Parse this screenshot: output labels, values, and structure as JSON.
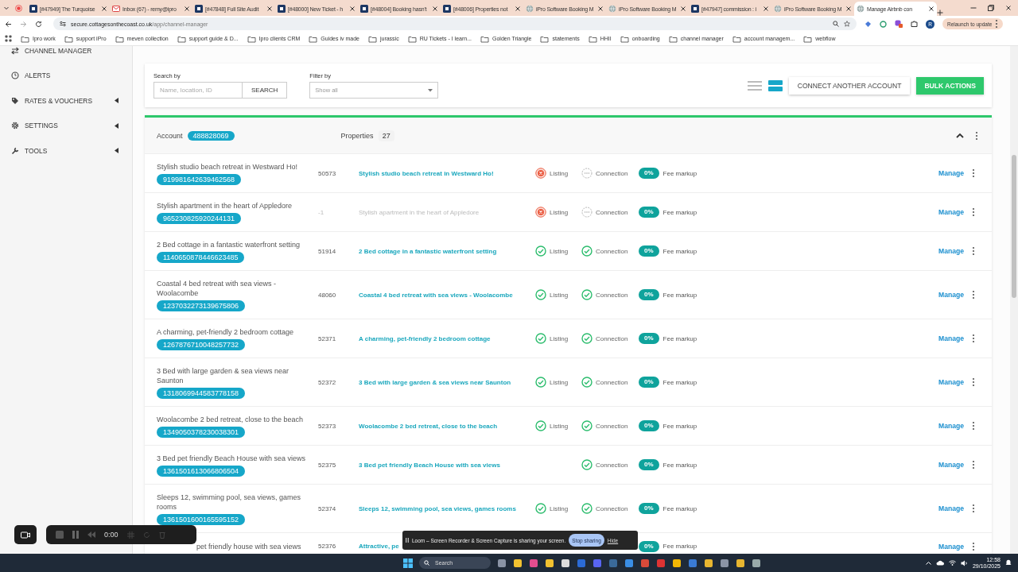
{
  "browser": {
    "tabs": [
      {
        "title": "[#47949] The Turquoise",
        "kind": "ticket",
        "selected": false
      },
      {
        "title": "Inbox (67) - remy@ipro",
        "kind": "mail",
        "selected": false
      },
      {
        "title": "[#47848] Full Site Audit",
        "kind": "ticket",
        "selected": false
      },
      {
        "title": "[#48000] New Ticket - h",
        "kind": "ticket",
        "selected": false
      },
      {
        "title": "[#48004] Booking hasn't",
        "kind": "ticket",
        "selected": false
      },
      {
        "title": "[#48006] Properties not",
        "kind": "ticket",
        "selected": false
      },
      {
        "title": "iPro Software Booking M",
        "kind": "globe",
        "selected": false
      },
      {
        "title": "iPro Software Booking M",
        "kind": "globe",
        "selected": false
      },
      {
        "title": "[#47947] commission : i",
        "kind": "ticket",
        "selected": false
      },
      {
        "title": "iPro Software Booking M",
        "kind": "globe",
        "selected": false
      },
      {
        "title": "Manage Airbnb con",
        "kind": "globe",
        "selected": true
      }
    ],
    "address": {
      "host": "secure.cottagesonthecoast.co.uk",
      "path": "/app/channel-manager"
    },
    "profile_initial": "R",
    "relaunch": "Relaunch to update",
    "bookmarks": [
      "Ipro work",
      "support iPro",
      "meven collection",
      "support guide & D...",
      "Ipro clients CRM",
      "Guides iv made",
      "jurassic",
      "RU Tickets - I learn...",
      "Golden Triangle",
      "statements",
      "HHII",
      "onboarding",
      "channel manager",
      "account managem...",
      "webflow"
    ]
  },
  "sidebar": {
    "items": [
      {
        "label": "CHANNEL MANAGER",
        "kind": "arrows",
        "has_submenu": false
      },
      {
        "label": "ALERTS",
        "kind": "clock",
        "has_submenu": false
      },
      {
        "label": "RATES & VOUCHERS",
        "kind": "tag",
        "has_submenu": true
      },
      {
        "label": "SETTINGS",
        "kind": "gear",
        "has_submenu": true
      },
      {
        "label": "TOOLS",
        "kind": "wrench",
        "has_submenu": true
      }
    ]
  },
  "filters": {
    "search": {
      "label": "Search by",
      "placeholder": "Name, location, ID",
      "button": "SEARCH"
    },
    "filter": {
      "label": "Filter by",
      "value": "Show all"
    },
    "views": [
      {
        "kind": "list",
        "selected": false
      },
      {
        "kind": "cards",
        "selected": true
      }
    ],
    "connect_button": "CONNECT ANOTHER ACCOUNT",
    "bulk_button": "BULK ACTIONS"
  },
  "account": {
    "label": "Account",
    "id": "488828069",
    "properties_label": "Properties",
    "properties_count": "27",
    "expanded": true,
    "listings": [
      {
        "kind": "full",
        "title": "Stylish studio beach retreat in Westward Ho!",
        "airbnb_id": "919981642639462568",
        "property_id": "50573",
        "link": "Stylish studio beach retreat in Westward Ho!",
        "linked": true,
        "listing": {
          "label": "Listing",
          "ok": false
        },
        "connection": {
          "label": "Connection",
          "connected": false
        },
        "fee": "0%",
        "fee_label": "Fee markup",
        "action": "Manage"
      },
      {
        "kind": "full",
        "title": "Stylish apartment in the heart of Appledore",
        "airbnb_id": "965230825920244131",
        "property_id": "-1",
        "link": "Stylish apartment in the heart of Appledore",
        "linked": false,
        "listing": {
          "label": "Listing",
          "ok": false
        },
        "connection": {
          "label": "Connection",
          "connected": false
        },
        "fee": "0%",
        "fee_label": "Fee markup",
        "action": "Manage"
      },
      {
        "kind": "full",
        "title": "2 Bed cottage in a fantastic waterfront setting",
        "airbnb_id": "1140650878446623485",
        "property_id": "51914",
        "link": "2 Bed cottage in a fantastic waterfront setting",
        "linked": true,
        "listing": {
          "label": "Listing",
          "ok": true
        },
        "connection": {
          "label": "Connection",
          "connected": true
        },
        "fee": "0%",
        "fee_label": "Fee markup",
        "action": "Manage"
      },
      {
        "kind": "full",
        "title": "Coastal 4 bed retreat with sea views - Woolacombe",
        "airbnb_id": "1237032273139675806",
        "property_id": "48060",
        "link": "Coastal 4 bed retreat with sea views - Woolacombe",
        "linked": true,
        "listing": {
          "label": "Listing",
          "ok": true
        },
        "connection": {
          "label": "Connection",
          "connected": true
        },
        "fee": "0%",
        "fee_label": "Fee markup",
        "action": "Manage"
      },
      {
        "kind": "full",
        "title": "A charming, pet-friendly 2 bedroom cottage",
        "airbnb_id": "1267876710048257732",
        "property_id": "52371",
        "link": "A charming, pet-friendly 2 bedroom cottage",
        "linked": true,
        "listing": {
          "label": "Listing",
          "ok": true
        },
        "connection": {
          "label": "Connection",
          "connected": true
        },
        "fee": "0%",
        "fee_label": "Fee markup",
        "action": "Manage"
      },
      {
        "kind": "full",
        "title": "3 Bed with large garden & sea views near Saunton",
        "airbnb_id": "1318069944583778158",
        "property_id": "52372",
        "link": "3 Bed with large garden & sea views near Saunton",
        "linked": true,
        "listing": {
          "label": "Listing",
          "ok": true
        },
        "connection": {
          "label": "Connection",
          "connected": true
        },
        "fee": "0%",
        "fee_label": "Fee markup",
        "action": "Manage"
      },
      {
        "kind": "full",
        "title": "Woolacombe 2 bed retreat, close to the beach",
        "airbnb_id": "1349050378230038301",
        "property_id": "52373",
        "link": "Woolacombe 2 bed retreat, close to the beach",
        "linked": true,
        "listing": {
          "label": "Listing",
          "ok": true
        },
        "connection": {
          "label": "Connection",
          "connected": true
        },
        "fee": "0%",
        "fee_label": "Fee markup",
        "action": "Manage"
      },
      {
        "kind": "full",
        "title": "3 Bed pet friendly Beach House with sea views",
        "airbnb_id": "1361501613066806504",
        "property_id": "52375",
        "link": "3 Bed pet friendly Beach House with sea views",
        "linked": true,
        "connection": {
          "label": "Connection",
          "connected": true
        },
        "fee": "0%",
        "fee_label": "Fee markup",
        "action": "Manage"
      },
      {
        "kind": "full",
        "title": "Sleeps 12, swimming pool, sea views, games rooms",
        "airbnb_id": "1361501600165595152",
        "property_id": "52374",
        "link": "Sleeps 12, swimming pool, sea views, games rooms",
        "linked": true,
        "listing": {
          "label": "Listing",
          "ok": true
        },
        "connection": {
          "label": "Connection",
          "connected": true
        },
        "fee": "0%",
        "fee_label": "Fee markup",
        "action": "Manage"
      },
      {
        "kind": "partial",
        "title": "pet friendly house with sea views",
        "property_id": "52376",
        "link": "Attractive, pe",
        "linked": true,
        "fee": "0%",
        "fee_label": "Fee markup",
        "action": "Manage"
      }
    ]
  },
  "loom": {
    "time": "0:00",
    "message": "Loom – Screen Recorder & Screen Capture is sharing your screen.",
    "stop_button": "Stop sharing",
    "hide_link": "Hide"
  },
  "taskbar": {
    "placeholder": "Search",
    "time": "12:58",
    "date": "29/10/2025"
  }
}
